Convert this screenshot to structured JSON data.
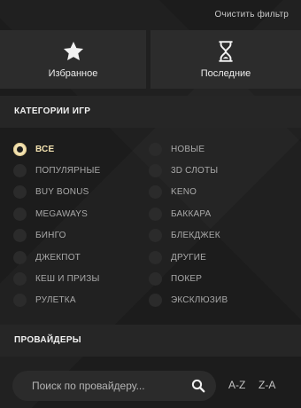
{
  "header": {
    "clear_filter": "Очистить фильтр"
  },
  "tiles": {
    "favorites": {
      "label": "Избранное",
      "icon": "star-icon"
    },
    "recent": {
      "label": "Последние",
      "icon": "hourglass-icon"
    }
  },
  "categories": {
    "title": "КАТЕГОРИИ ИГР",
    "selected": "ВСЕ",
    "left": [
      "ВСЕ",
      "ПОПУЛЯРНЫЕ",
      "BUY BONUS",
      "MEGAWAYS",
      "БИНГО",
      "ДЖЕКПОТ",
      "КЕШ И ПРИЗЫ",
      "РУЛЕТКА"
    ],
    "right": [
      "НОВЫЕ",
      "3D СЛОТЫ",
      "KENO",
      "БАККАРА",
      "БЛЕКДЖЕК",
      "ДРУГИЕ",
      "ПОКЕР",
      "ЭКСКЛЮЗИВ"
    ]
  },
  "providers": {
    "title": "ПРОВАЙДЕРЫ",
    "search_placeholder": "Поиск по провайдеру...",
    "sort_az": "A-Z",
    "sort_za": "Z-A"
  },
  "colors": {
    "accent": "#f3e2b0",
    "panel": "#2c2c2c",
    "background": "#1c1c1c"
  }
}
